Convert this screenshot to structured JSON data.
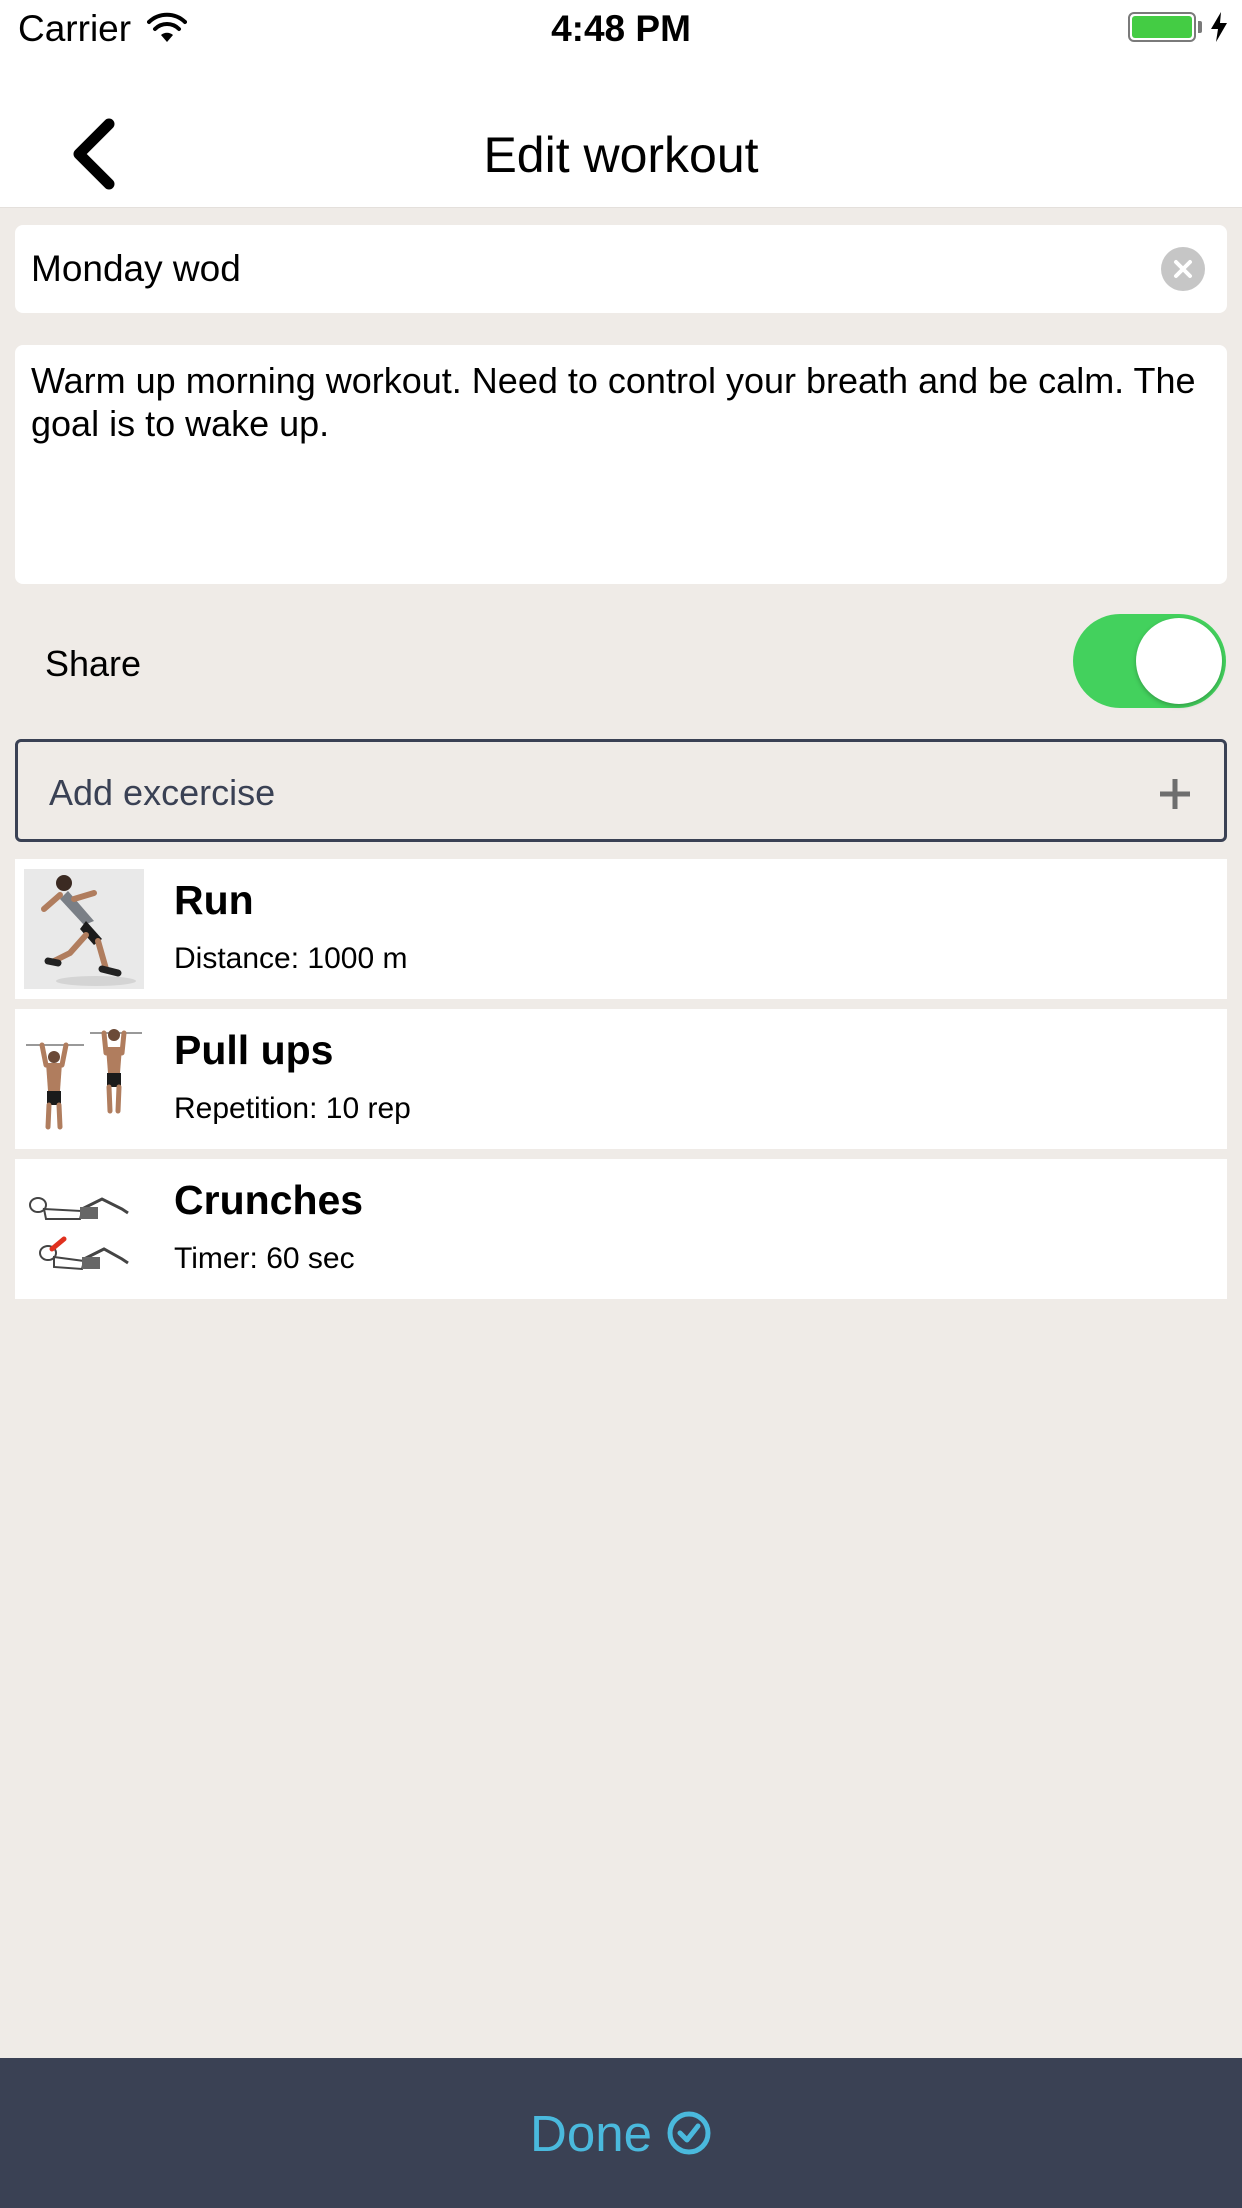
{
  "status_bar": {
    "carrier": "Carrier",
    "time": "4:48 PM",
    "wifi_icon": "wifi-icon",
    "battery_icon": "battery-icon",
    "charging_icon": "bolt-icon",
    "battery_level": 1.0,
    "battery_color": "#44cc44"
  },
  "nav": {
    "title": "Edit workout",
    "back_icon": "chevron-left-icon"
  },
  "form": {
    "name_value": "Monday wod",
    "clear_icon": "close-circle-icon",
    "description": "Warm up morning workout. Need to control your breath and be calm. The goal is to wake up.",
    "share_label": "Share",
    "share_enabled": true,
    "toggle_color": "#43d15d"
  },
  "add_exercise": {
    "label": "Add excercise",
    "icon": "plus-icon"
  },
  "exercises": [
    {
      "name": "Run",
      "detail": "Distance: 1000 m",
      "thumb": "runner-image"
    },
    {
      "name": "Pull ups",
      "detail": "Repetition: 10 rep",
      "thumb": "pullup-image"
    },
    {
      "name": "Crunches",
      "detail": "Timer: 60 sec",
      "thumb": "crunches-image"
    }
  ],
  "done": {
    "label": "Done",
    "icon": "check-circle-icon",
    "bar_color": "#3a4154",
    "accent_color": "#4ab9dd"
  }
}
